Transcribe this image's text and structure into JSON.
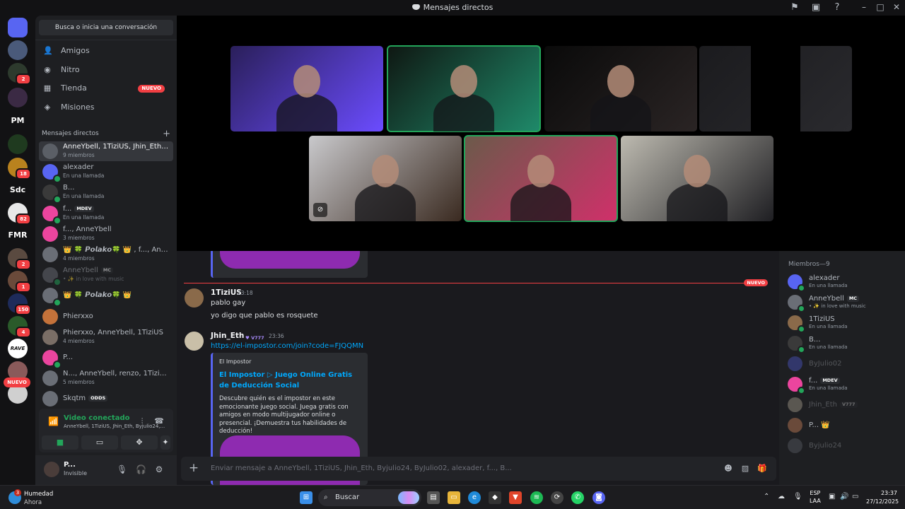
{
  "window": {
    "title": "Mensajes directos"
  },
  "guilds": [
    {
      "label": "",
      "badge": "",
      "color": "#5865f2",
      "icon": "discord-logo-icon"
    },
    {
      "label": "",
      "badge": "",
      "color": "#4a5a7a"
    },
    {
      "label": "",
      "badge": "2",
      "color": "#2d3a2d"
    },
    {
      "label": "",
      "badge": "",
      "color": "#3b2a44"
    },
    {
      "label": "PM",
      "badge": "",
      "color": "#121214"
    },
    {
      "label": "",
      "badge": "",
      "color": "#1f3a1f"
    },
    {
      "label": "",
      "badge": "18",
      "color": "#b9821e"
    },
    {
      "label": "Sdc",
      "badge": "",
      "color": "#121214"
    },
    {
      "label": "",
      "badge": "82",
      "color": "#e8e8e8"
    },
    {
      "label": "FMR",
      "badge": "",
      "color": "#121214"
    },
    {
      "label": "",
      "badge": "2",
      "color": "#5a4a40"
    },
    {
      "label": "",
      "badge": "1",
      "color": "#6a4a3a"
    },
    {
      "label": "",
      "badge": "150",
      "color": "#1e2b5a"
    },
    {
      "label": "",
      "badge": "4",
      "color": "#2a5a2a"
    },
    {
      "label": "",
      "badge": "",
      "color": "#ffffff",
      "text": "RAVE"
    },
    {
      "label": "",
      "badge": "",
      "color": "#8a5a5a"
    },
    {
      "label": "",
      "badge": "",
      "color": "#d0d0d0"
    }
  ],
  "guilds_new": "NUEVO",
  "sidebar": {
    "search": "Busca o inicia una conversación",
    "nav": [
      {
        "label": "Amigos",
        "icon": "friends-icon"
      },
      {
        "label": "Nitro",
        "icon": "nitro-icon"
      },
      {
        "label": "Tienda",
        "icon": "shop-icon",
        "badge": "NUEVO"
      },
      {
        "label": "Misiones",
        "icon": "quests-icon"
      }
    ],
    "dm_header": "Mensajes directos",
    "dms": [
      {
        "name": "AnneYbell, 1TiziUS, Jhin_Eth, ...",
        "sub": "9 miembros",
        "active": true,
        "color": "#5b5f66",
        "dot": false
      },
      {
        "name": "alexader",
        "sub": "En una llamada",
        "color": "#5865f2",
        "dot": true
      },
      {
        "name": "B...",
        "sub": "En una llamada",
        "color": "#3a3a3a",
        "dot": true
      },
      {
        "name": "f...",
        "tag": "MDEV",
        "sub": "En una llamada",
        "color": "#eb459e",
        "dot": true
      },
      {
        "name": "f..., AnneYbell",
        "sub": "3 miembros",
        "color": "#eb459e",
        "dot": false
      },
      {
        "name": "👑 🍀 𝙋𝙤𝙡𝙖𝙠𝙤🍀 👑 , f..., Ann...",
        "sub": "4 miembros",
        "color": "#6a6e76",
        "dot": false
      },
      {
        "name": "AnneYbell",
        "tag": "MC",
        "sub": "• ✨ in love with music",
        "color": "#6a6e76",
        "dot": true,
        "faded": true
      },
      {
        "name": "👑 🍀 𝙋𝙤𝙡𝙖𝙠𝙤🍀 👑",
        "sub": "",
        "color": "#6a6e76",
        "dot": true
      },
      {
        "name": "Phierxxo",
        "sub": "",
        "color": "#c4723a",
        "dot": false
      },
      {
        "name": "Phierxxo, AnneYbell, 1TiziUS",
        "sub": "4 miembros",
        "color": "#7a6e66",
        "dot": false
      },
      {
        "name": "P...",
        "sub": "",
        "color": "#eb459e",
        "dot": true
      },
      {
        "name": "N..., AnneYbell, renzo, 1TiziUS",
        "sub": "5 miembros",
        "color": "#6a6e76",
        "dot": false
      },
      {
        "name": "Skqtm",
        "tag": "ODDS",
        "sub": "",
        "color": "#6a6e76",
        "dot": false
      }
    ]
  },
  "voice": {
    "title": "Video conectado",
    "participants": "AnneYbell, 1TiziUS, Jhin_Eth, Byjulio24,...",
    "buttons": [
      {
        "name": "camera-button",
        "icon": "camera-icon"
      },
      {
        "name": "screen-share-button",
        "icon": "screen-share-icon"
      },
      {
        "name": "activities-button",
        "icon": "activities-icon"
      },
      {
        "name": "soundboard-button",
        "icon": "soundboard-icon"
      }
    ]
  },
  "user": {
    "name": "P...",
    "status": "Invisible"
  },
  "call_tiles": [
    {
      "color": "#2a1f5a",
      "accent": "#6b4cff",
      "speaking": false
    },
    {
      "color": "#0f1712",
      "accent": "#1f8a6a",
      "speaking": true
    },
    {
      "color": "#0a0a0a",
      "accent": "#2a2424",
      "speaking": false
    },
    {
      "color": "#1b1b1e",
      "accent": "#2a2a2e",
      "speaking": false
    },
    {
      "color": "#c9c9cc",
      "accent": "#3a2a20",
      "speaking": false,
      "muted": true
    },
    {
      "color": "#6b5a4a",
      "accent": "#d0306a",
      "speaking": true
    },
    {
      "color": "#bdbab0",
      "accent": "#1e1e22",
      "speaking": false
    }
  ],
  "chat": {
    "new_label": "NUEVO",
    "messages": [
      {
        "author": "1TiziUS",
        "time": "23:18",
        "lines": [
          "pablo gay",
          "yo digo que pablo es rosquete"
        ],
        "avatar": "#8a6a4a"
      },
      {
        "author": "Jhin_Eth",
        "tag": "V777",
        "time": "23:36",
        "link": "https://el-impostor.com/join?code=FJQQMN",
        "avatar": "#c9bfa8",
        "embed": {
          "provider": "El Impostor",
          "title": "El Impostor ▷ Juego Online Gratis de Deducción Social",
          "description": "Descubre quién es el impostor en este emocionante juego social. Juega gratis con amigos en modo multijugador online o presencial. ¡Demuestra tus habilidades de deducción!"
        }
      }
    ],
    "composer_placeholder": "Enviar mensaje a AnneYbell, 1TiziUS, Jhin_Eth, Byjulio24, ByJulio02, alexader, f..., B..."
  },
  "members": {
    "header": "Miembros—9",
    "list": [
      {
        "name": "alexader",
        "sub": "En una llamada",
        "color": "#5865f2",
        "dot": true
      },
      {
        "name": "AnneYbell",
        "tag": "MC",
        "sub": "• ✨ in love with music",
        "color": "#6a6e76",
        "dot": true
      },
      {
        "name": "1TiziUS",
        "sub": "En una llamada",
        "color": "#8a6a4a",
        "dot": true
      },
      {
        "name": "B...",
        "sub": "En una llamada",
        "color": "#3a3a3a",
        "dot": true
      },
      {
        "name": "ByJulio02",
        "sub": "",
        "color": "#5865f2",
        "dot": false,
        "faded": true
      },
      {
        "name": "f...",
        "tag": "MDEV",
        "sub": "En una llamada",
        "color": "#eb459e",
        "dot": true
      },
      {
        "name": "Jhin_Eth",
        "tag": "V777",
        "sub": "",
        "color": "#c9bfa8",
        "dot": false,
        "faded": true
      },
      {
        "name": "P...",
        "suffix": "👑",
        "sub": "",
        "color": "#6a4a3a",
        "dot": false
      },
      {
        "name": "Byjulio24",
        "sub": "",
        "color": "#6a6e76",
        "dot": false,
        "faded": true
      }
    ]
  },
  "taskbar": {
    "weather_title": "Humedad",
    "weather_sub": "Ahora",
    "weather_badge": "3",
    "search": "Buscar",
    "lang_1": "ESP",
    "lang_2": "LAA",
    "time": "23:37",
    "date": "27/12/2025"
  }
}
